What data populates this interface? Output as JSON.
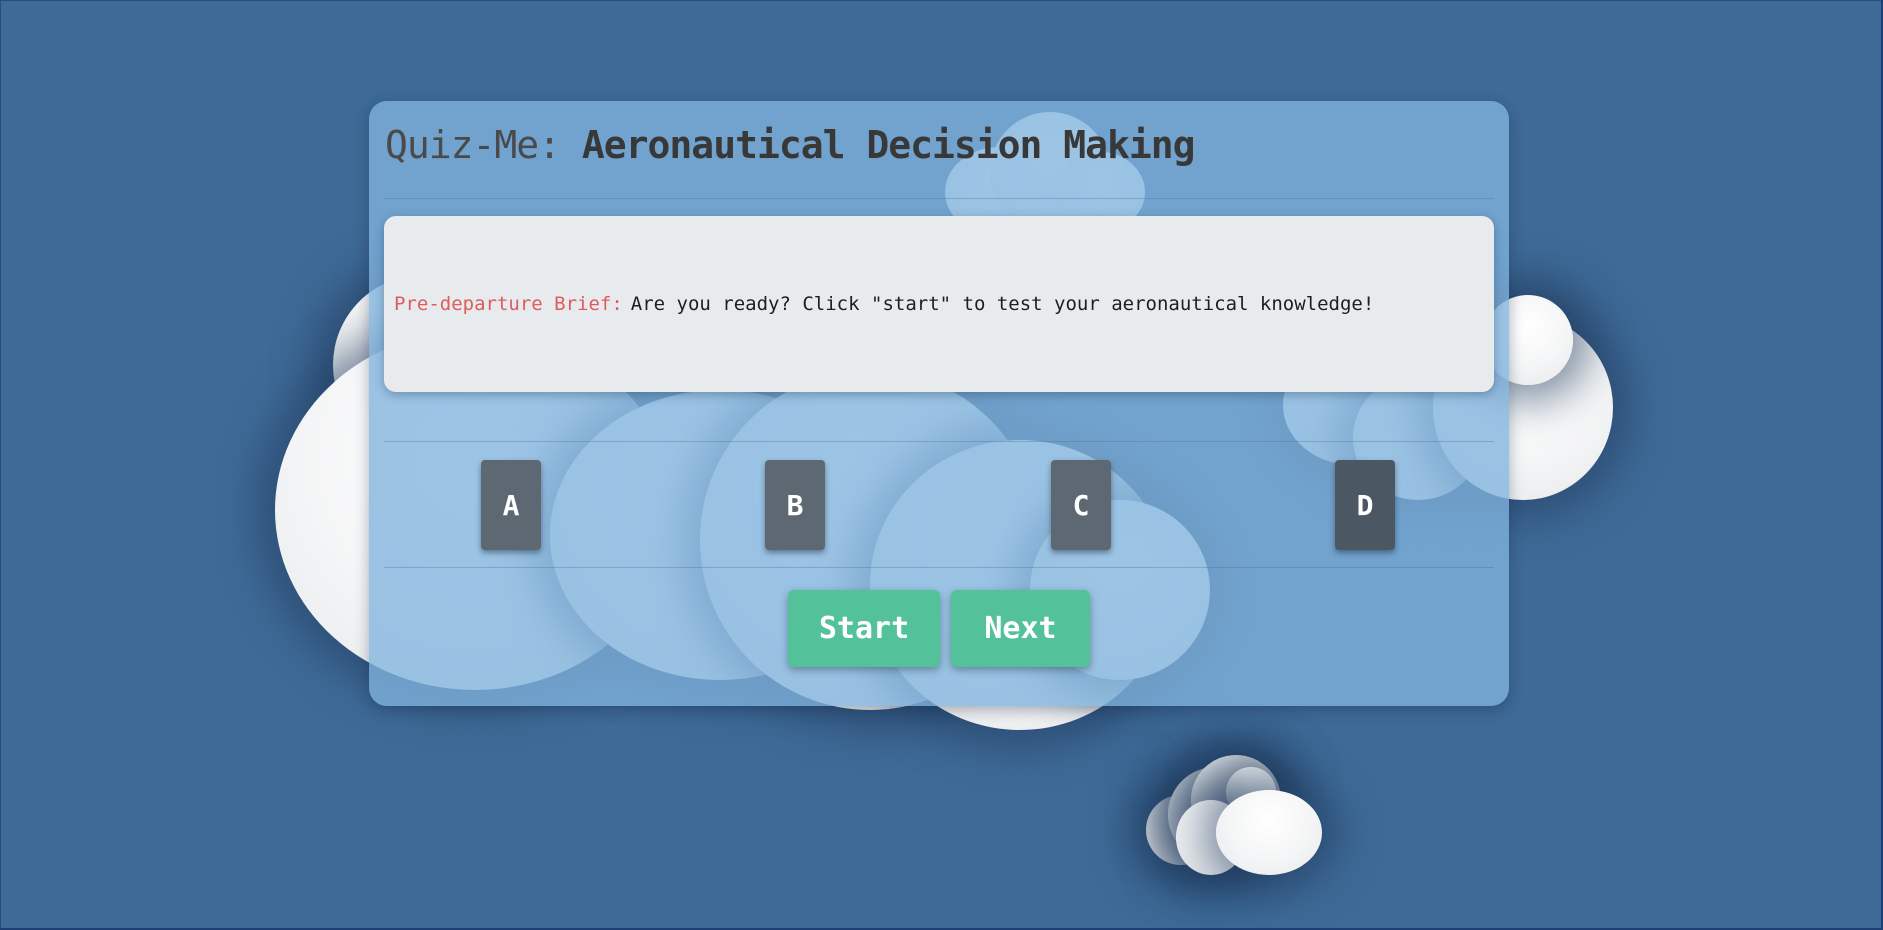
{
  "app": {
    "title_brand": "Quiz-Me:",
    "title_topic": "Aeronautical Decision Making"
  },
  "brief": {
    "label": "Pre-departure Brief:",
    "message": "Are you ready? Click \"start\" to test your aeronautical knowledge!"
  },
  "answers": [
    {
      "label": "A"
    },
    {
      "label": "B"
    },
    {
      "label": "C"
    },
    {
      "label": "D"
    }
  ],
  "controls": {
    "start_label": "Start",
    "next_label": "Next"
  },
  "colors": {
    "background": "#3e6a97",
    "card": "#80b4de",
    "brief_panel": "#e8ebee",
    "brief_label": "#e05b5b",
    "answer_button": "#5d6872",
    "action_button": "#53c29b"
  }
}
